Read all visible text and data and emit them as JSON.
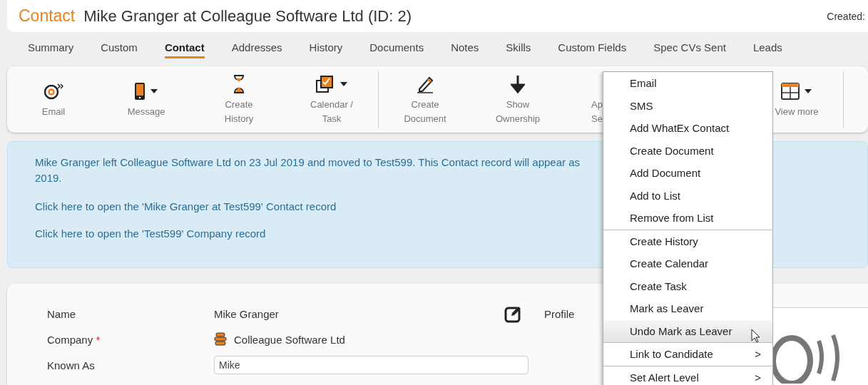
{
  "header": {
    "type_label": "Contact",
    "title": "Mike Granger at Colleague Software Ltd (ID: 2)",
    "created_label": "Created:"
  },
  "tabs": [
    {
      "label": "Summary",
      "selected": false
    },
    {
      "label": "Custom",
      "selected": false
    },
    {
      "label": "Contact",
      "selected": true
    },
    {
      "label": "Addresses",
      "selected": false
    },
    {
      "label": "History",
      "selected": false
    },
    {
      "label": "Documents",
      "selected": false
    },
    {
      "label": "Notes",
      "selected": false
    },
    {
      "label": "Skills",
      "selected": false
    },
    {
      "label": "Custom Fields",
      "selected": false
    },
    {
      "label": "Spec CVs Sent",
      "selected": false
    },
    {
      "label": "Leads",
      "selected": false
    }
  ],
  "toolbar": {
    "groups": [
      [
        {
          "lines": [
            "Email"
          ],
          "dropdown": false
        },
        {
          "lines": [
            "Message"
          ],
          "dropdown": true
        },
        {
          "lines": [
            "Create",
            "History"
          ],
          "dropdown": false
        },
        {
          "lines": [
            "Calendar /",
            "Task"
          ],
          "dropdown": true
        }
      ],
      [
        {
          "lines": [
            "Create",
            "Document"
          ],
          "dropdown": false
        },
        {
          "lines": [
            "Show",
            "Ownership"
          ],
          "dropdown": false
        },
        {
          "lines": [
            "Ap",
            "Se"
          ]
        }
      ],
      [
        {
          "lines": [
            "View more"
          ],
          "dropdown": true
        }
      ]
    ]
  },
  "banner": {
    "lines": [
      "Mike Granger left Colleague Software Ltd on 23 Jul 2019 and moved to Test599. This Contact record will appear as",
      "2019."
    ],
    "links": [
      "Click here to open the 'Mike Granger at Test599' Contact record",
      "Click here to open the 'Test599' Company record"
    ]
  },
  "form": {
    "name_label": "Name",
    "name_value": "Mike Granger",
    "company_label": "Company",
    "required_mark": "*",
    "company_value": "Colleague Software Ltd",
    "known_as_label": "Known As",
    "known_as_value": "Mike",
    "profile_label": "Profile"
  },
  "menu": {
    "groups": [
      [
        {
          "label": "Email",
          "selected": false
        },
        {
          "label": "SMS",
          "selected": false
        },
        {
          "label": "Add WhatEx Contact",
          "selected": false
        },
        {
          "label": "Create Document",
          "selected": false
        },
        {
          "label": "Add Document",
          "selected": false
        },
        {
          "label": "Add to List",
          "selected": false
        },
        {
          "label": "Remove from List",
          "selected": false
        }
      ],
      [
        {
          "label": "Create History",
          "selected": false
        },
        {
          "label": "Create Calendar",
          "selected": false
        },
        {
          "label": "Create Task",
          "selected": false
        },
        {
          "label": "Mark as Leaver",
          "selected": false
        },
        {
          "label": "Undo Mark as Leaver",
          "selected": true
        }
      ],
      [
        {
          "label": "Link to Candidate",
          "arrow": ">",
          "selected": false
        }
      ],
      [
        {
          "label": "Set Alert Level",
          "arrow": ">",
          "selected": false
        }
      ]
    ]
  }
}
